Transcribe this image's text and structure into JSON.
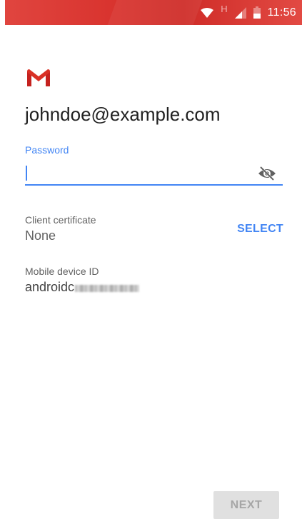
{
  "status_bar": {
    "time": "11:56",
    "network_type": "H",
    "icons": [
      "wifi-icon",
      "signal-icon",
      "battery-icon"
    ],
    "color": "#d9342f"
  },
  "logo": {
    "icon": "gmail-logo-icon",
    "color": "#d93025"
  },
  "account": {
    "email": "johndoe@example.com"
  },
  "password": {
    "label": "Password",
    "value": "",
    "toggle_icon": "eye-off-icon"
  },
  "client_certificate": {
    "label": "Client certificate",
    "value": "None",
    "action_label": "SELECT"
  },
  "mobile_device_id": {
    "label": "Mobile device ID",
    "value_prefix": "androidc"
  },
  "footer": {
    "next_label": "NEXT"
  },
  "colors": {
    "accent": "#4285f4",
    "text_primary": "#212121",
    "text_secondary": "#616161",
    "disabled_bg": "#e0e0e0"
  }
}
